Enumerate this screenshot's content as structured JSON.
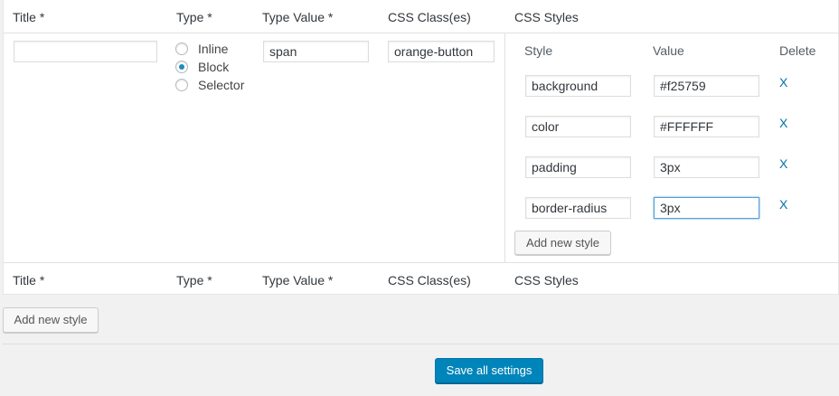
{
  "columns": {
    "title": "Title *",
    "type": "Type *",
    "type_value": "Type Value *",
    "css_classes": "CSS Class(es)",
    "css_styles": "CSS Styles"
  },
  "row": {
    "title_value": "",
    "type_options": [
      {
        "label": "Inline",
        "checked": false
      },
      {
        "label": "Block",
        "checked": true
      },
      {
        "label": "Selector",
        "checked": false
      }
    ],
    "type_value": "span",
    "css_class": "orange-button"
  },
  "styles_table": {
    "style_header": "Style",
    "value_header": "Value",
    "delete_header": "Delete",
    "rows": [
      {
        "style": "background",
        "value": "#f25759",
        "delete": "X"
      },
      {
        "style": "color",
        "value": "#FFFFFF",
        "delete": "X"
      },
      {
        "style": "padding",
        "value": "3px",
        "delete": "X"
      },
      {
        "style": "border-radius",
        "value": "3px",
        "delete": "X"
      }
    ],
    "add_button": "Add new style"
  },
  "footer": {
    "add_style_button": "Add new style",
    "save_button": "Save all settings"
  },
  "colors": {
    "primary": "#0085ba",
    "link": "#0073aa",
    "radio_checked": "#1e8cbe",
    "focus_border": "#5b9dd9"
  }
}
